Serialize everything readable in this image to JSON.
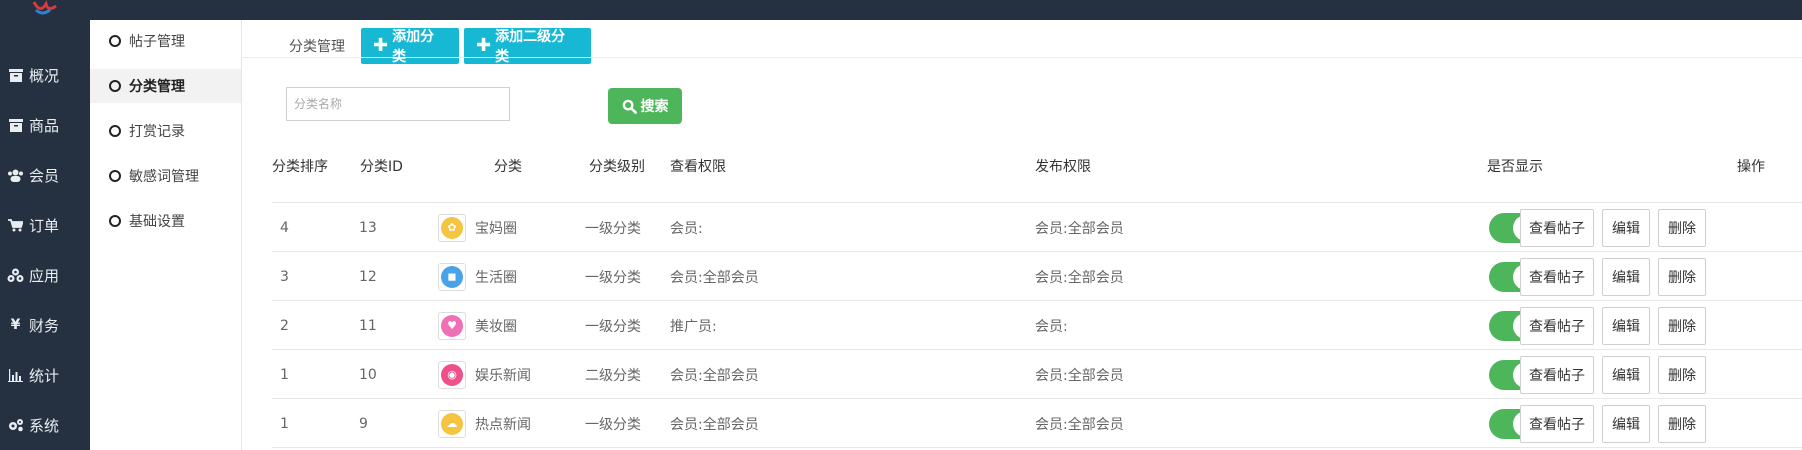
{
  "colors": {
    "nav_bg": "#253140",
    "accent_cyan": "#17b8d3",
    "accent_green": "#4db65a"
  },
  "left_nav": [
    {
      "label": "概况",
      "icon": "archive-icon"
    },
    {
      "label": "商品",
      "icon": "archive-icon"
    },
    {
      "label": "会员",
      "icon": "users-icon"
    },
    {
      "label": "订单",
      "icon": "cart-icon"
    },
    {
      "label": "应用",
      "icon": "cubes-icon"
    },
    {
      "label": "财务",
      "icon": "yen-icon"
    },
    {
      "label": "统计",
      "icon": "bar-chart-icon"
    },
    {
      "label": "系统",
      "icon": "gears-icon"
    }
  ],
  "sub_nav": [
    {
      "label": "帖子管理",
      "active": false
    },
    {
      "label": "分类管理",
      "active": true
    },
    {
      "label": "打赏记录",
      "active": false
    },
    {
      "label": "敏感词管理",
      "active": false
    },
    {
      "label": "基础设置",
      "active": false
    }
  ],
  "toolbar": {
    "crumb": "分类管理",
    "add_category": "添加分类",
    "add_sub_category": "添加二级分类",
    "search_placeholder": "分类名称",
    "search_label": "搜索"
  },
  "table": {
    "headers": [
      "分类排序",
      "分类ID",
      "分类",
      "分类级别",
      "查看权限",
      "发布权限",
      "是否显示",
      "操作"
    ],
    "rows": [
      {
        "sort": "4",
        "id": "13",
        "name": "宝妈圈",
        "level": "一级分类",
        "view": "会员:",
        "publish": "会员:全部会员",
        "show": true,
        "icon_color": "#f5c542"
      },
      {
        "sort": "3",
        "id": "12",
        "name": "生活圈",
        "level": "一级分类",
        "view": "会员:全部会员",
        "publish": "会员:全部会员",
        "show": true,
        "icon_color": "#4aa3e8"
      },
      {
        "sort": "2",
        "id": "11",
        "name": "美妆圈",
        "level": "一级分类",
        "view": "推广员:",
        "publish": "会员:",
        "show": true,
        "icon_color": "#f06fb5"
      },
      {
        "sort": "1",
        "id": "10",
        "name": "娱乐新闻",
        "level": "二级分类",
        "view": "会员:全部会员",
        "publish": "会员:全部会员",
        "show": true,
        "icon_color": "#f0508a"
      },
      {
        "sort": "1",
        "id": "9",
        "name": "热点新闻",
        "level": "一级分类",
        "view": "会员:全部会员",
        "publish": "会员:全部会员",
        "show": true,
        "icon_color": "#f5c542"
      }
    ],
    "actions": {
      "view_posts": "查看帖子",
      "edit": "编辑",
      "delete": "删除"
    }
  }
}
